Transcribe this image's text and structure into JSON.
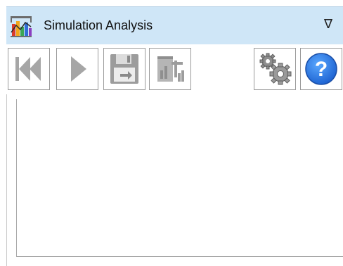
{
  "window": {
    "title": "Simulation Analysis",
    "menu_glyph": "∇",
    "icon": "chart-app-icon"
  },
  "toolbar": {
    "buttons": [
      {
        "name": "first-frame-button",
        "icon": "skip-to-start-icon",
        "enabled": false
      },
      {
        "name": "play-button",
        "icon": "play-icon",
        "enabled": false
      },
      {
        "name": "save-button",
        "icon": "floppy-disk-icon",
        "enabled": false
      },
      {
        "name": "export-button",
        "icon": "export-chart-icon",
        "enabled": false
      },
      {
        "name": "settings-button",
        "icon": "gears-icon",
        "enabled": true
      },
      {
        "name": "help-button",
        "icon": "help-icon",
        "enabled": true,
        "glyph": "?"
      }
    ]
  },
  "colors": {
    "titlebar_bg": "#cfe6f7",
    "disabled_icon": "#a6a6a6",
    "help_blue": "#1e73d8"
  }
}
